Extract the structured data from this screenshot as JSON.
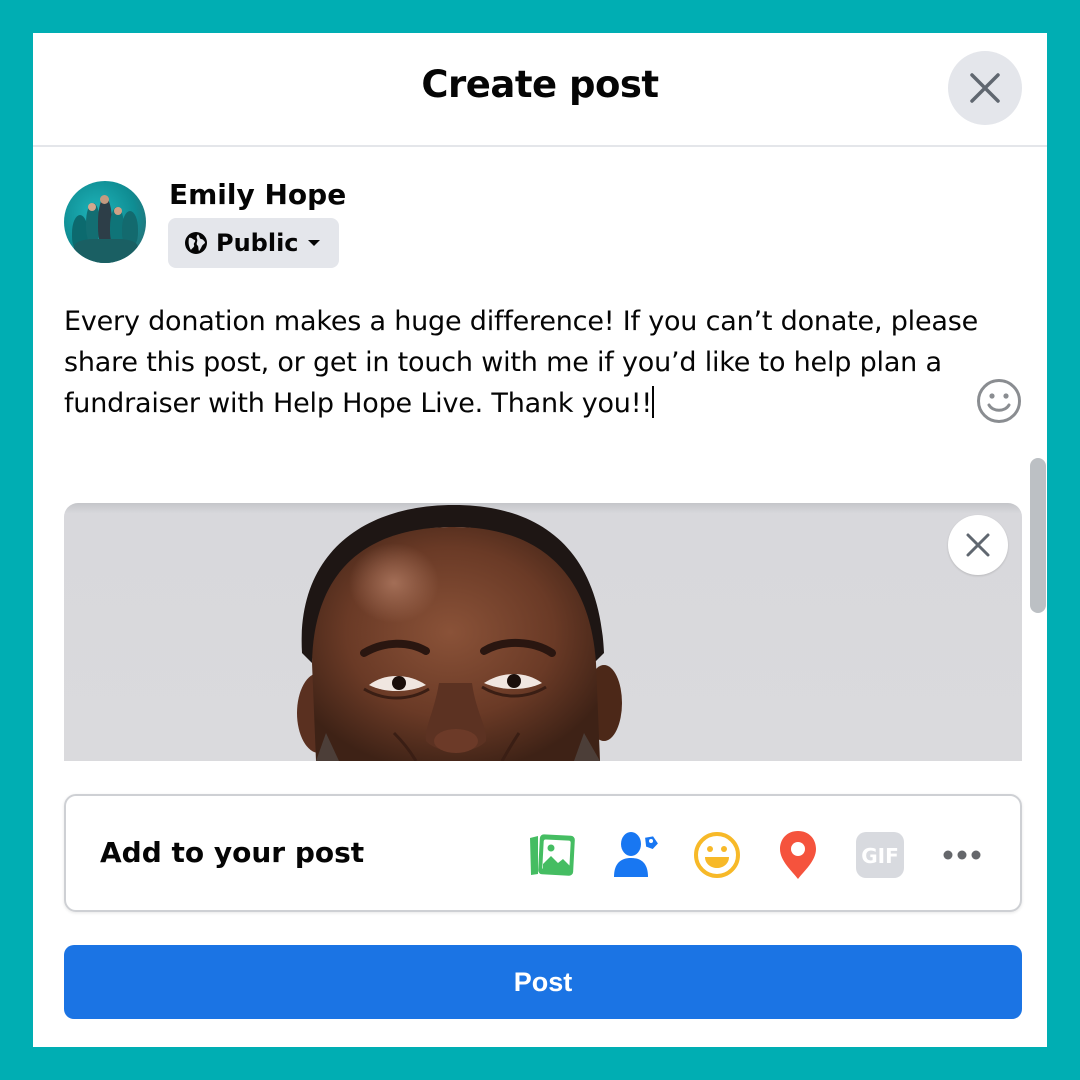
{
  "dialog": {
    "title": "Create post",
    "close_icon": "close-icon"
  },
  "author": {
    "name": "Emily Hope",
    "audience": {
      "label": "Public",
      "icon": "globe-icon",
      "dropdown_icon": "caret-down-icon"
    }
  },
  "composer": {
    "text": "Every donation makes a huge difference! If you can’t donate, please share this post, or get in touch with me if you’d like to help plan a fundraiser with Help Hope Live. Thank you!!",
    "emoji_icon": "smiley-icon"
  },
  "attachment": {
    "type": "photo",
    "description": "Close-up of a smiling man against a light gray background",
    "remove_icon": "close-icon"
  },
  "add_to_post": {
    "label": "Add to your post",
    "items": [
      {
        "name": "Photo/video",
        "icon": "photo-icon",
        "color": "#45bd62"
      },
      {
        "name": "Tag people",
        "icon": "tag-people-icon",
        "color": "#1877f2"
      },
      {
        "name": "Feeling/activity",
        "icon": "feeling-icon",
        "color": "#f7b928"
      },
      {
        "name": "Check in",
        "icon": "location-pin-icon",
        "color": "#f5533d"
      },
      {
        "name": "GIF",
        "icon": "gif-icon",
        "text": "GIF",
        "color": "#d8dadf"
      },
      {
        "name": "More",
        "icon": "more-icon",
        "color": "#65676b"
      }
    ]
  },
  "submit": {
    "label": "Post"
  },
  "colors": {
    "background": "#00aeb3",
    "primary": "#1b74e4",
    "chip": "#e4e6eb"
  }
}
